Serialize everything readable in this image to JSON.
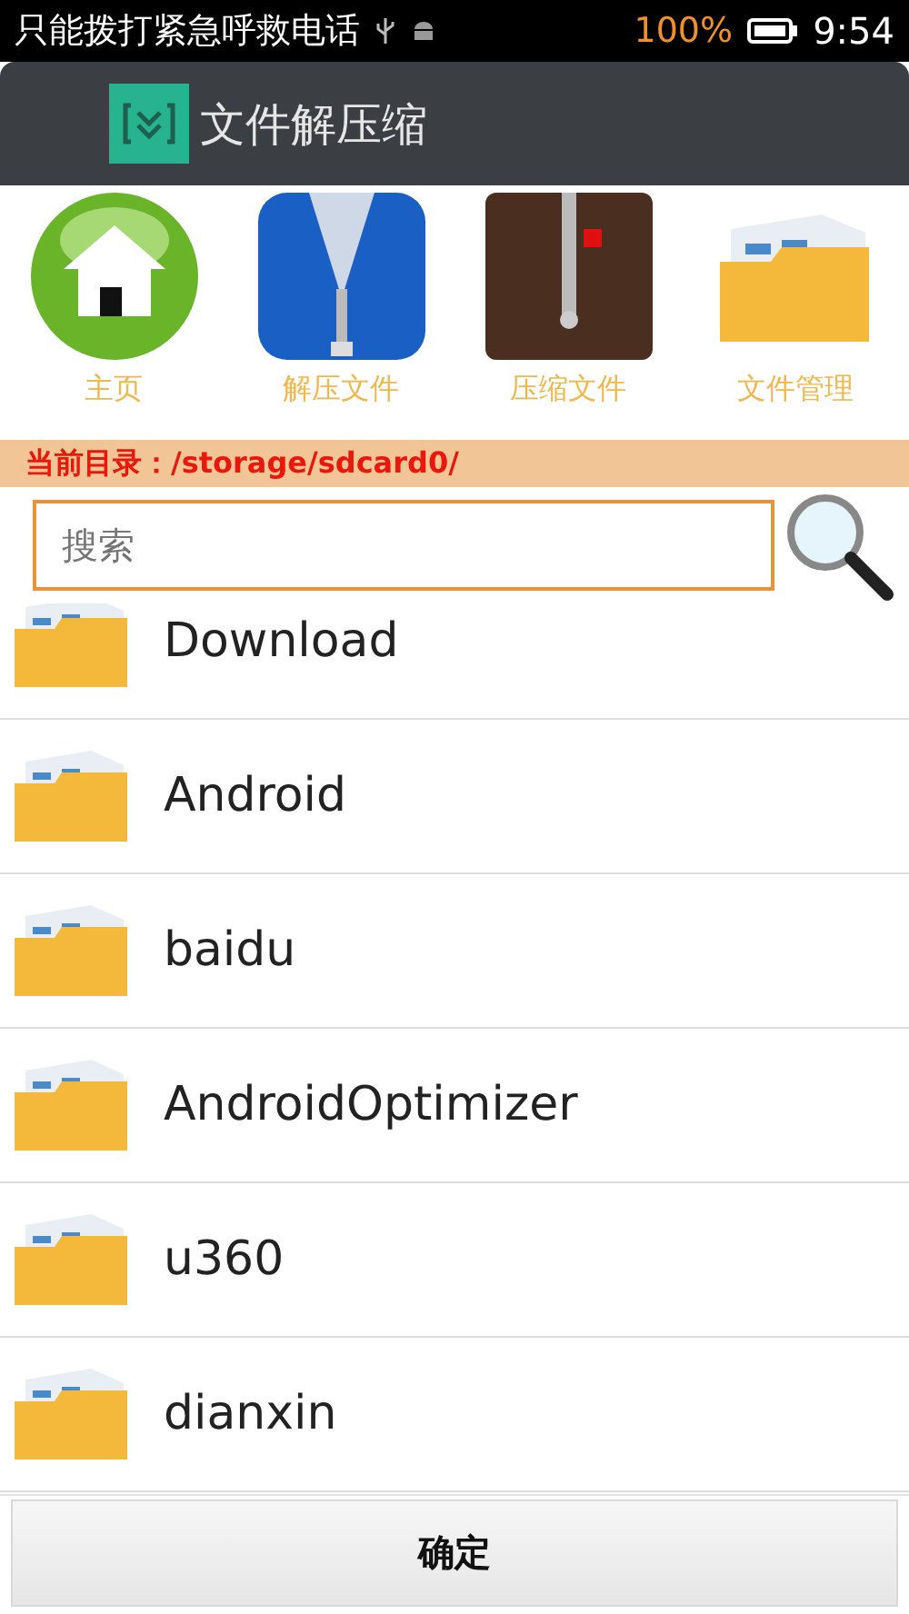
{
  "status_bar": {
    "notice": "只能拨打紧急呼救电话",
    "battery": "100%",
    "time": "9:54"
  },
  "app_bar": {
    "title": "文件解压缩"
  },
  "shortcuts": [
    {
      "label": "主页",
      "kind": "home"
    },
    {
      "label": "解压文件",
      "kind": "unzip"
    },
    {
      "label": "压缩文件",
      "kind": "zip"
    },
    {
      "label": "文件管理",
      "kind": "folder"
    }
  ],
  "path_bar": {
    "text": "当前目录：/storage/sdcard0/"
  },
  "search": {
    "placeholder": "搜索"
  },
  "folders": [
    {
      "name": "Download"
    },
    {
      "name": "Android"
    },
    {
      "name": "baidu"
    },
    {
      "name": "AndroidOptimizer"
    },
    {
      "name": "u360"
    },
    {
      "name": "dianxin"
    }
  ],
  "buttons": [
    "确定"
  ]
}
